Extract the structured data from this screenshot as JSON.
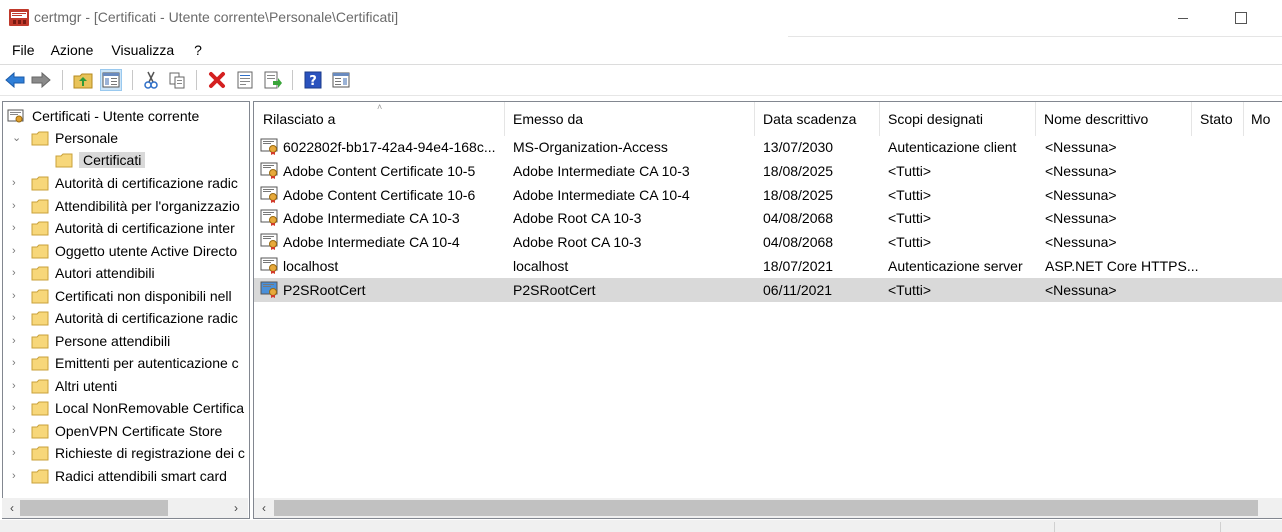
{
  "window": {
    "title": "certmgr - [Certificati - Utente corrente\\Personale\\Certificati]"
  },
  "menu": [
    "File",
    "Azione",
    "Visualizza",
    "?"
  ],
  "toolbar": {
    "icons": [
      "back-arrow-icon",
      "forward-arrow-icon",
      "up-folder-icon",
      "show-hide-console-tree-icon",
      "cut-icon",
      "copy-icon",
      "delete-icon",
      "properties-icon",
      "export-list-icon",
      "help-icon",
      "show-hide-action-pane-icon"
    ],
    "active": "show-hide-console-tree-icon"
  },
  "tree": {
    "root": "Certificati - Utente corrente",
    "personale": "Personale",
    "selected": "Certificati",
    "items": [
      "Autorità di certificazione radic",
      "Attendibilità per l'organizzazio",
      "Autorità di certificazione inter",
      "Oggetto utente Active Directo",
      "Autori attendibili",
      "Certificati non disponibili nell",
      "Autorità di certificazione radic",
      "Persone attendibili",
      "Emittenti per autenticazione c",
      "Altri utenti",
      "Local NonRemovable Certifica",
      "OpenVPN Certificate Store",
      "Richieste di registrazione dei c",
      "Radici attendibili smart card"
    ]
  },
  "list": {
    "columns": [
      "Rilasciato a",
      "Emesso da",
      "Data scadenza",
      "Scopi designati",
      "Nome descrittivo",
      "Stato",
      "Mo"
    ],
    "rows": [
      {
        "issued_to": "6022802f-bb17-42a4-94e4-168c...",
        "issued_by": "MS-Organization-Access",
        "expires": "13/07/2030",
        "purposes": "Autenticazione client",
        "friendly": "<Nessuna>",
        "status": ""
      },
      {
        "issued_to": "Adobe Content Certificate 10-5",
        "issued_by": "Adobe Intermediate CA 10-3",
        "expires": "18/08/2025",
        "purposes": "<Tutti>",
        "friendly": "<Nessuna>",
        "status": ""
      },
      {
        "issued_to": "Adobe Content Certificate 10-6",
        "issued_by": "Adobe Intermediate CA 10-4",
        "expires": "18/08/2025",
        "purposes": "<Tutti>",
        "friendly": "<Nessuna>",
        "status": ""
      },
      {
        "issued_to": "Adobe Intermediate CA 10-3",
        "issued_by": "Adobe Root CA 10-3",
        "expires": "04/08/2068",
        "purposes": "<Tutti>",
        "friendly": "<Nessuna>",
        "status": ""
      },
      {
        "issued_to": "Adobe Intermediate CA 10-4",
        "issued_by": "Adobe Root CA 10-3",
        "expires": "04/08/2068",
        "purposes": "<Tutti>",
        "friendly": "<Nessuna>",
        "status": ""
      },
      {
        "issued_to": "localhost",
        "issued_by": "localhost",
        "expires": "18/07/2021",
        "purposes": "Autenticazione server",
        "friendly": "ASP.NET Core HTTPS...",
        "status": ""
      },
      {
        "issued_to": "P2SRootCert",
        "issued_by": "P2SRootCert",
        "expires": "06/11/2021",
        "purposes": "<Tutti>",
        "friendly": "<Nessuna>",
        "status": ""
      }
    ],
    "selected_row": 6
  },
  "scrollbar": {
    "left_arrow": "‹",
    "right_arrow": "›"
  }
}
